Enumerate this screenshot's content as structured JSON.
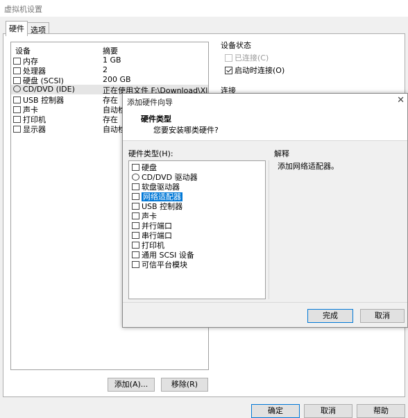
{
  "window": {
    "title": "虚拟机设置"
  },
  "tabs": [
    {
      "label": "硬件"
    },
    {
      "label": "选项"
    }
  ],
  "devices": {
    "col_device": "设备",
    "col_summary": "摘要",
    "rows": [
      {
        "icon": "memory-icon",
        "name": "内存",
        "summary": "1 GB"
      },
      {
        "icon": "cpu-icon",
        "name": "处理器",
        "summary": "2"
      },
      {
        "icon": "harddisk-icon",
        "name": "硬盘 (SCSI)",
        "summary": "200 GB"
      },
      {
        "icon": "cd-dvd-icon",
        "name": "CD/DVD (IDE)",
        "summary": "正在使用文件 F:\\Download\\Xl"
      },
      {
        "icon": "usb-icon",
        "name": "USB 控制器",
        "summary": "存在"
      },
      {
        "icon": "sound-card-icon",
        "name": "声卡",
        "summary": "自动检"
      },
      {
        "icon": "printer-icon",
        "name": "打印机",
        "summary": "存在"
      },
      {
        "icon": "display-icon",
        "name": "显示器",
        "summary": "自动检"
      }
    ],
    "selected_index": 3
  },
  "device_status": {
    "title": "设备状态",
    "connected_label": "已连接(C)",
    "connected_checked": false,
    "connect_at_power_on_label": "启动时连接(O)",
    "connect_at_power_on_checked": true
  },
  "connection": {
    "title": "连接"
  },
  "bottom_buttons": {
    "add": "添加(A)...",
    "remove": "移除(R)"
  },
  "dialog_buttons": {
    "ok": "确定",
    "cancel": "取消",
    "help": "帮助"
  },
  "wizard": {
    "title": "添加硬件向导",
    "close_glyph": "✕",
    "header_title": "硬件类型",
    "header_subtitle": "您要安装哪类硬件?",
    "list_label": "硬件类型(H):",
    "items": [
      {
        "icon": "harddisk-icon",
        "label": "硬盘"
      },
      {
        "icon": "cd-dvd-icon",
        "label": "CD/DVD 驱动器"
      },
      {
        "icon": "floppy-icon",
        "label": "软盘驱动器"
      },
      {
        "icon": "network-adapter-icon",
        "label": "网络适配器"
      },
      {
        "icon": "usb-icon",
        "label": "USB 控制器"
      },
      {
        "icon": "sound-card-icon",
        "label": "声卡"
      },
      {
        "icon": "parallel-port-icon",
        "label": "并行端口"
      },
      {
        "icon": "serial-port-icon",
        "label": "串行端口"
      },
      {
        "icon": "printer-icon",
        "label": "打印机"
      },
      {
        "icon": "generic-scsi-icon",
        "label": "通用 SCSI 设备"
      },
      {
        "icon": "tpm-icon",
        "label": "可信平台模块"
      }
    ],
    "selected_index": 3,
    "explain_title": "解释",
    "explain_text": "添加网络适配器。",
    "finish": "完成",
    "cancel": "取消"
  },
  "colors": {
    "selection": "#0078d7",
    "primary_border": "#0078d7"
  }
}
